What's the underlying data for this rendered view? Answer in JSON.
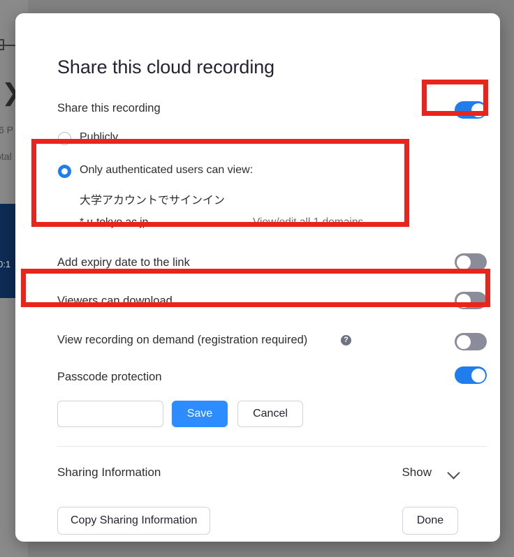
{
  "background": {
    "fragment_top": "6 P",
    "fragment_second": "otal",
    "video_time": "0:1",
    "chevron": "❯"
  },
  "modal": {
    "title": "Share this cloud recording",
    "share_recording": {
      "label": "Share this recording",
      "toggle_state": "on"
    },
    "access_options": [
      {
        "label": "Publicly",
        "selected": false
      },
      {
        "label": "Only authenticated users can view:",
        "selected": true
      }
    ],
    "auth_detail": {
      "sign_in_text": "大学アカウントでサインイン",
      "domain": "*.u-tokyo.ac.jp",
      "domains_link": "View/edit all 1 domains"
    },
    "settings": [
      {
        "label": "Add expiry date to the link",
        "toggle_state": "off"
      },
      {
        "label": "Viewers can download",
        "toggle_state": "off"
      },
      {
        "label": "View recording on demand (registration required)",
        "toggle_state": "off",
        "help": "?"
      },
      {
        "label": "Passcode protection",
        "toggle_state": "on"
      }
    ],
    "passcode": {
      "value": "",
      "placeholder": "",
      "save_label": "Save",
      "cancel_label": "Cancel"
    },
    "sharing_information": {
      "label": "Sharing Information",
      "show_label": "Show"
    },
    "footer": {
      "copy_label": "Copy Sharing Information",
      "done_label": "Done"
    }
  },
  "colors": {
    "accent_blue": "#2d8cff",
    "toggle_on": "#1f7ded",
    "toggle_off": "#8a8d99",
    "annotation_red": "#e8241d",
    "backdrop": "#818181",
    "video_panel": "#0d2b54"
  }
}
